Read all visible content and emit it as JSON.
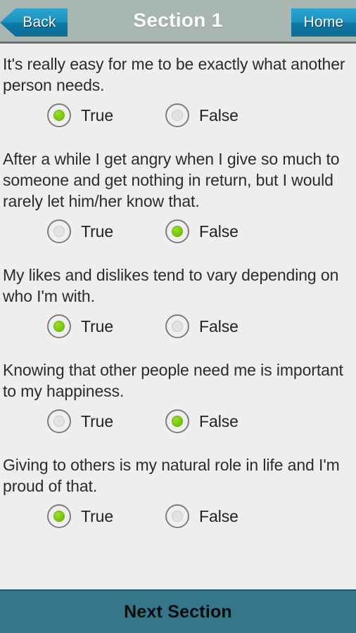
{
  "header": {
    "back_label": "Back",
    "title": "Section 1",
    "home_label": "Home"
  },
  "colors": {
    "header_bg": "#a9b7b2",
    "button_blue_top": "#2ba4cf",
    "button_blue_bottom": "#0d6c95",
    "content_bg": "#eeeeee",
    "footer_teal": "#34778a",
    "radio_selected_green": "#7cc70e",
    "radio_ring_gray": "#7d7d7d",
    "text_dark": "#2b2b2b"
  },
  "options_labels": {
    "true_label": "True",
    "false_label": "False"
  },
  "questions": [
    {
      "text": "It's really easy for me to be exactly what another person needs.",
      "true_label": "True",
      "false_label": "False",
      "selected": "true"
    },
    {
      "text": "After a while I get angry when I give so much to someone and get nothing in return, but I would rarely let him/her know that.",
      "true_label": "True",
      "false_label": "False",
      "selected": "false"
    },
    {
      "text": "My likes and dislikes tend to vary depending on who I'm with.",
      "true_label": "True",
      "false_label": "False",
      "selected": "true"
    },
    {
      "text": "Knowing that other people need me is important to my happiness.",
      "true_label": "True",
      "false_label": "False",
      "selected": "false"
    },
    {
      "text": "Giving to others is my natural role in life and I'm proud of that.",
      "true_label": "True",
      "false_label": "False",
      "selected": "true"
    }
  ],
  "footer": {
    "next_label": "Next Section"
  }
}
